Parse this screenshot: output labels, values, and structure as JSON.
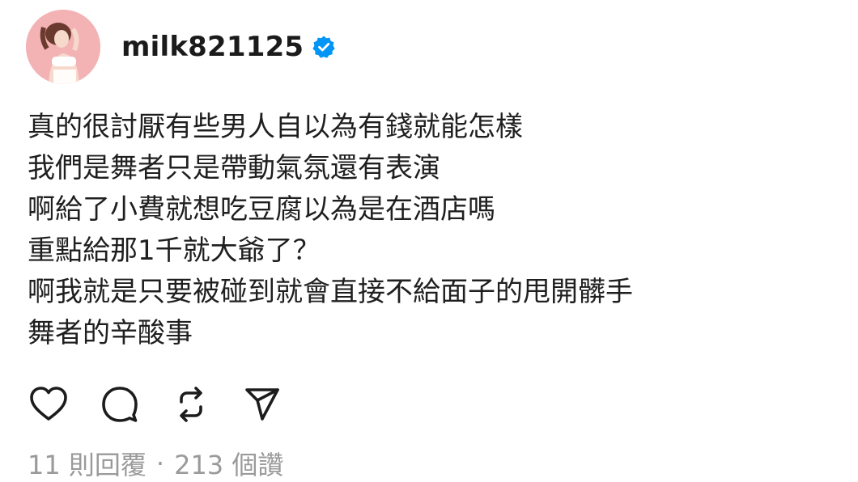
{
  "post": {
    "username": "milk821125",
    "verified": true,
    "accent_color": "#0095f6",
    "avatar_bg": "#f4b6b8",
    "lines": [
      "真的很討厭有些男人自以為有錢就能怎樣",
      "我們是舞者只是帶動氣氛還有表演",
      "啊給了小費就想吃豆腐以為是在酒店嗎",
      "重點給那1千就大爺了？",
      "啊我就是只要被碰到就會直接不給面子的甩開髒手",
      "舞者的辛酸事"
    ],
    "actions": {
      "like_icon": "heart-icon",
      "comment_icon": "comment-icon",
      "repost_icon": "repost-icon",
      "share_icon": "send-icon"
    },
    "stats": {
      "replies": "11 則回覆",
      "separator": "·",
      "likes": "213 個讚"
    }
  }
}
